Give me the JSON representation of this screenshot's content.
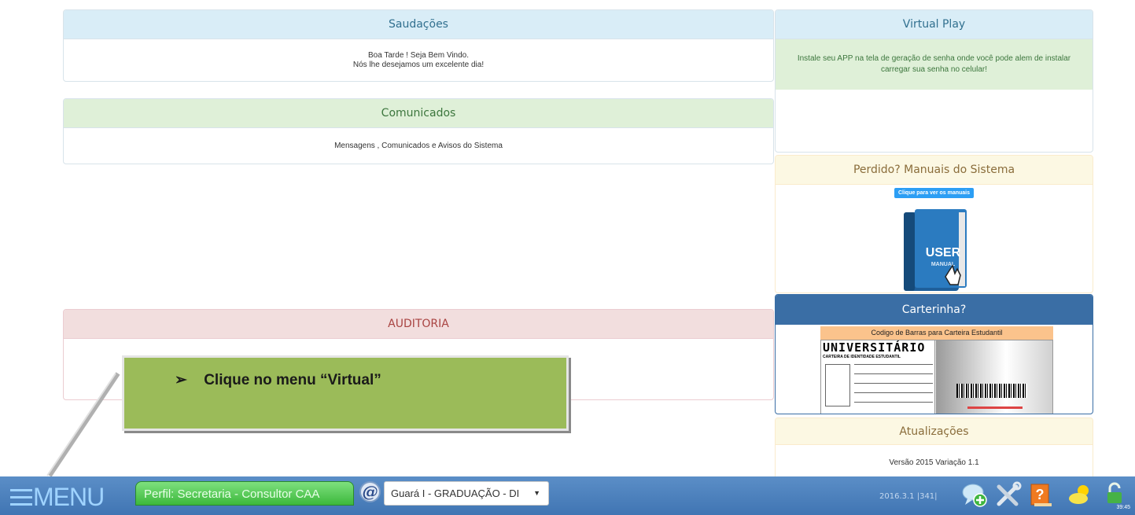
{
  "greeting": {
    "title": "Saudações",
    "line1": "Boa Tarde ! Seja Bem Vindo.",
    "line2": "Nós lhe desejamos um excelente dia!"
  },
  "announcements": {
    "title": "Comunicados",
    "text": "Mensagens , Comunicados e Avisos do Sistema"
  },
  "audit": {
    "title": "AUDITORIA"
  },
  "virtual_play": {
    "title": "Virtual Play",
    "message": "Instale seu APP na tela de geração de senha onde você pode alem de instalar carregar sua senha no celular!"
  },
  "manuals": {
    "title": "Perdido? Manuais do Sistema",
    "button_label": "Clique para ver os manuais",
    "book_text_1": "USER",
    "book_text_2": "MANUAL"
  },
  "student_card": {
    "title": "Carterinha?",
    "caption": "Codigo de Barras para Carteira Estudantil",
    "card_heading": "UNIVERSITÁRIO",
    "card_subheading": "CARTEIRA DE IDENTIDADE ESTUDANTIL"
  },
  "updates": {
    "title": "Atualizações",
    "version_text": "Versão 2015 Variação 1.1"
  },
  "callout": {
    "bullet": "➢",
    "text": "Clique no menu “Virtual”"
  },
  "taskbar": {
    "menu_label": "MENU",
    "profile_label": "Perfil: Secretaria - Consultor CAA",
    "campus_select_value": "Guará I - GRADUAÇÃO - DI",
    "version_info": "2016.3.1 |341|",
    "timer": "39:45",
    "icons": [
      "chat-add-icon",
      "tools-icon",
      "help-book-icon",
      "weather-icon",
      "lock-icon"
    ]
  },
  "colors": {
    "taskbar": "#4a7fbc",
    "callout": "#9bbb59",
    "profile_tab": "#4cc34c"
  }
}
